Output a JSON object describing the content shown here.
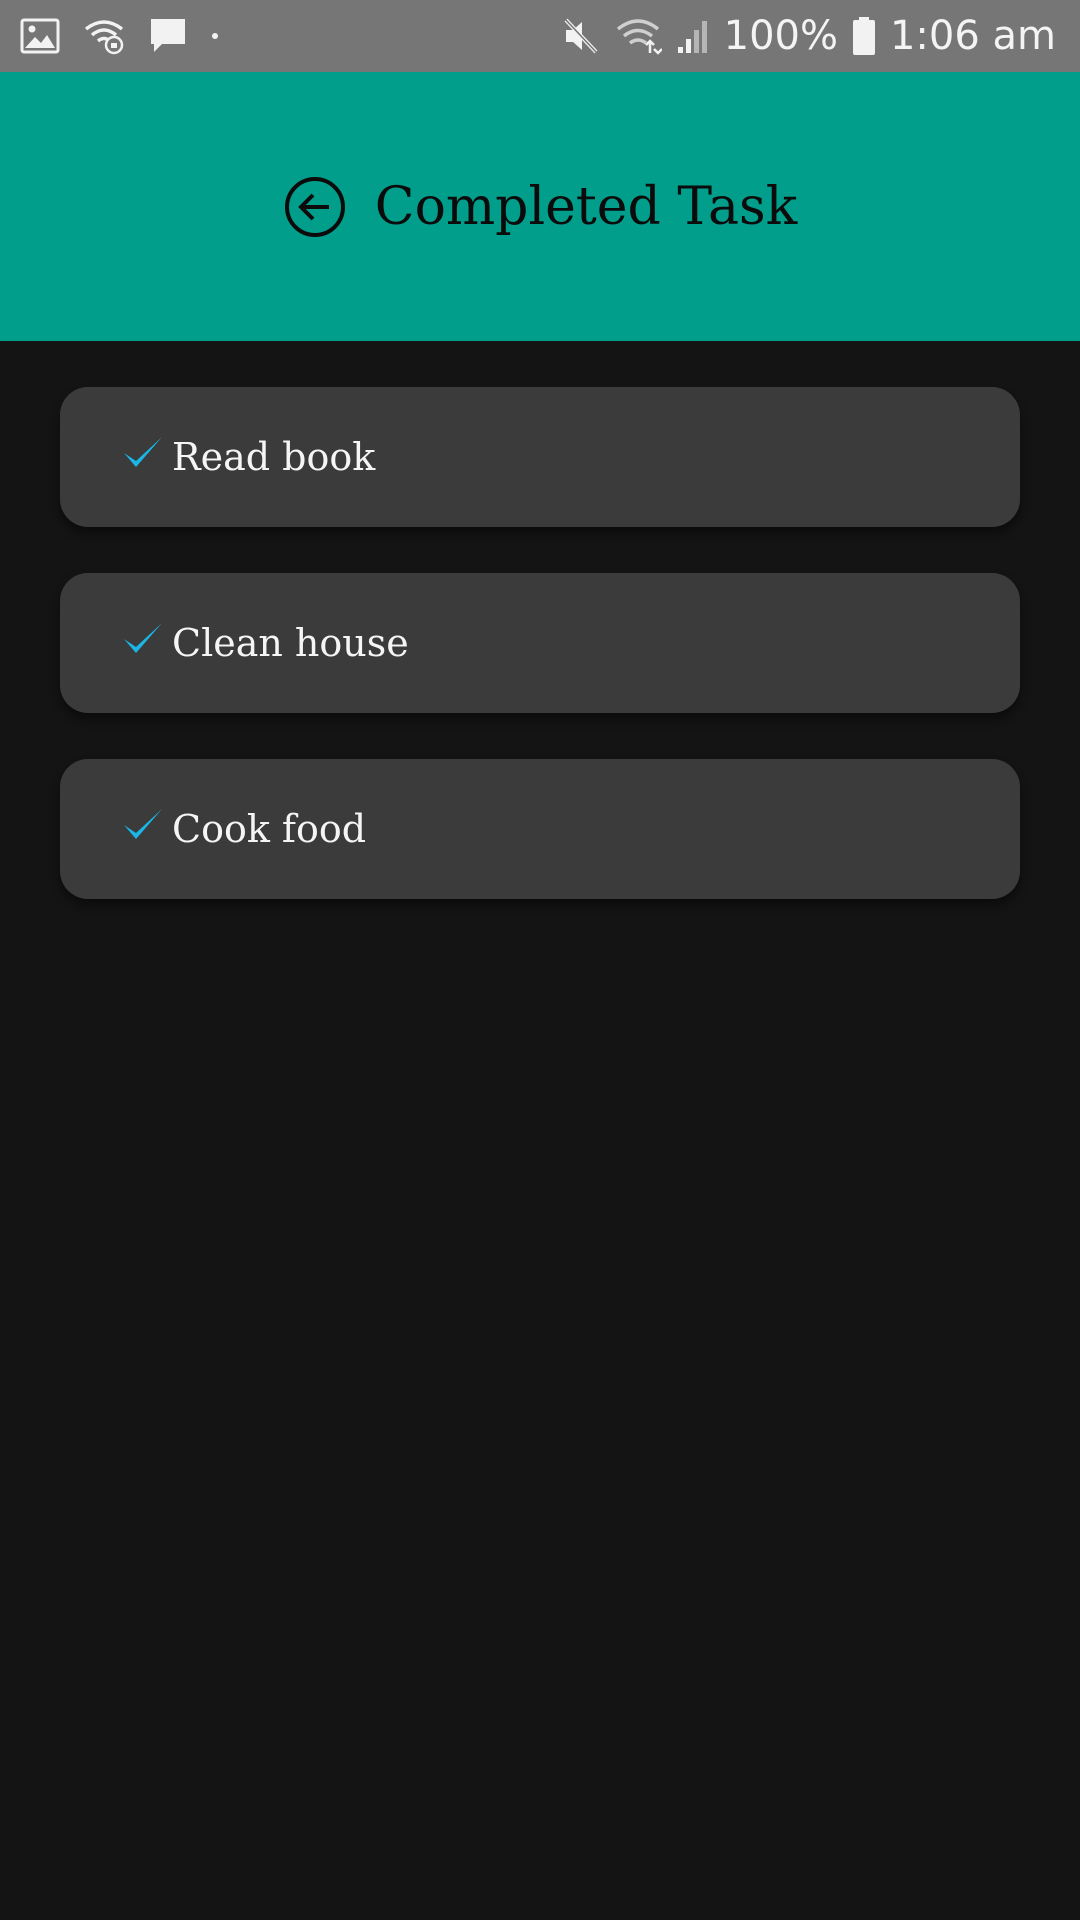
{
  "status_bar": {
    "left_icons": [
      "image-icon",
      "wifi-calling-icon",
      "message-icon",
      "dot-icon"
    ],
    "right_icons": [
      "mute-icon",
      "wifi-icon",
      "signal-icon",
      "battery-icon"
    ],
    "battery_percent": "100%",
    "time": "1:06 am"
  },
  "header": {
    "title": "Completed Task",
    "back_icon": "back-arrow-circle-icon",
    "background_color": "#009e8b"
  },
  "tasks": [
    {
      "label": "Read book",
      "completed": true
    },
    {
      "label": "Clean house",
      "completed": true
    },
    {
      "label": "Cook food",
      "completed": true
    }
  ],
  "colors": {
    "background": "#141414",
    "card": "#3b3b3b",
    "check": "#1ab7e6",
    "status_bar": "#767676"
  }
}
